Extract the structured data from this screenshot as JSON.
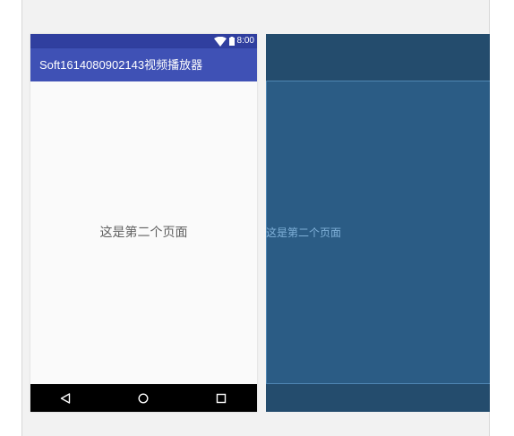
{
  "status_bar": {
    "time": "8:00",
    "background": "#303f9f",
    "icons": [
      "wifi-icon",
      "battery-icon"
    ]
  },
  "app_bar": {
    "title": "Soft1614080902143视频播放器",
    "background": "#3f51b5"
  },
  "content": {
    "text": "这是第二个页面"
  },
  "nav_bar": {
    "buttons": [
      "back-icon",
      "home-icon",
      "recents-icon"
    ]
  },
  "blueprint": {
    "text": "这是第二个页面",
    "background": "#2b5c85",
    "outline_color": "#4f86b3"
  }
}
